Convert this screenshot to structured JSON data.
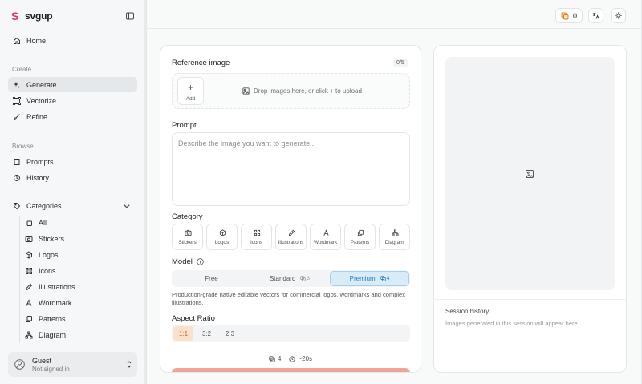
{
  "brand": {
    "name": "svgup",
    "logo_glyph": "S",
    "accent": "#e4307a"
  },
  "sidebar": {
    "home": "Home",
    "create_label": "Create",
    "create_items": [
      "Generate",
      "Vectorize",
      "Refine"
    ],
    "active_item": "Generate",
    "browse_label": "Browse",
    "browse_items": [
      "Prompts",
      "History"
    ],
    "categories_label": "Categories",
    "category_items": [
      "All",
      "Stickers",
      "Logos",
      "Icons",
      "Illustrations",
      "Wordmark",
      "Patterns",
      "Diagram"
    ]
  },
  "user": {
    "name": "Guest",
    "status": "Not signed in"
  },
  "topbar": {
    "credits": "0"
  },
  "form": {
    "reference_label": "Reference image",
    "reference_counter": "0/5",
    "add_label": "Add",
    "drop_text": "Drop images here, or click + to upload",
    "prompt_label": "Prompt",
    "prompt_placeholder": "Describe the image you want to generate...",
    "category_label": "Category",
    "categories": [
      {
        "label": "Stickers",
        "icon": "camera-icon"
      },
      {
        "label": "Logos",
        "icon": "box-icon"
      },
      {
        "label": "Icons",
        "icon": "grid-icon"
      },
      {
        "label": "Illustrations",
        "icon": "pen-icon"
      },
      {
        "label": "Wordmark",
        "icon": "type-icon"
      },
      {
        "label": "Patterns",
        "icon": "layers-icon"
      },
      {
        "label": "Diagram",
        "icon": "network-icon"
      }
    ],
    "model_label": "Model",
    "models": [
      {
        "label": "Free",
        "cost": ""
      },
      {
        "label": "Standard",
        "cost": "3"
      },
      {
        "label": "Premium",
        "cost": "4"
      }
    ],
    "active_model": "Premium",
    "model_description": "Production-grade native editable vectors for commercial logos, wordmarks and complex illustrations.",
    "aspect_label": "Aspect Ratio",
    "ratios": [
      "1:1",
      "3:2",
      "2:3"
    ],
    "active_ratio": "1:1",
    "cost": "4",
    "time_estimate": "~20s",
    "generate_color": "#f0a39b"
  },
  "preview": {
    "history_title": "Session history",
    "history_empty": "Images generated in this session will appear here."
  }
}
